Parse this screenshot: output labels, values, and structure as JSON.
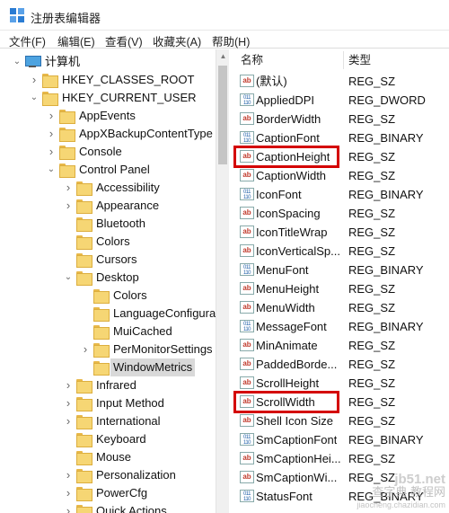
{
  "window": {
    "title": "注册表编辑器",
    "icon": "regedit-icon"
  },
  "menu": [
    "文件(F)",
    "编辑(E)",
    "查看(V)",
    "收藏夹(A)",
    "帮助(H)"
  ],
  "tree": [
    {
      "label": "计算机",
      "level": 0,
      "chevron": "expanded",
      "icon": "computer-icon"
    },
    {
      "label": "HKEY_CLASSES_ROOT",
      "level": 1,
      "chevron": "collapsed",
      "icon": "folder-icon"
    },
    {
      "label": "HKEY_CURRENT_USER",
      "level": 1,
      "chevron": "expanded",
      "icon": "folder-icon"
    },
    {
      "label": "AppEvents",
      "level": 2,
      "chevron": "collapsed",
      "icon": "folder-icon"
    },
    {
      "label": "AppXBackupContentType",
      "level": 2,
      "chevron": "collapsed",
      "icon": "folder-icon"
    },
    {
      "label": "Console",
      "level": 2,
      "chevron": "collapsed",
      "icon": "folder-icon"
    },
    {
      "label": "Control Panel",
      "level": 2,
      "chevron": "expanded",
      "icon": "folder-icon"
    },
    {
      "label": "Accessibility",
      "level": 3,
      "chevron": "collapsed",
      "icon": "folder-icon"
    },
    {
      "label": "Appearance",
      "level": 3,
      "chevron": "collapsed",
      "icon": "folder-icon"
    },
    {
      "label": "Bluetooth",
      "level": 3,
      "chevron": "none",
      "icon": "folder-icon"
    },
    {
      "label": "Colors",
      "level": 3,
      "chevron": "none",
      "icon": "folder-icon"
    },
    {
      "label": "Cursors",
      "level": 3,
      "chevron": "none",
      "icon": "folder-icon"
    },
    {
      "label": "Desktop",
      "level": 3,
      "chevron": "expanded",
      "icon": "folder-icon"
    },
    {
      "label": "Colors",
      "level": 4,
      "chevron": "none",
      "icon": "folder-icon"
    },
    {
      "label": "LanguageConfigura",
      "level": 4,
      "chevron": "none",
      "icon": "folder-icon"
    },
    {
      "label": "MuiCached",
      "level": 4,
      "chevron": "none",
      "icon": "folder-icon"
    },
    {
      "label": "PerMonitorSettings",
      "level": 4,
      "chevron": "collapsed",
      "icon": "folder-icon"
    },
    {
      "label": "WindowMetrics",
      "level": 4,
      "chevron": "none",
      "icon": "folder-icon",
      "selected": true
    },
    {
      "label": "Infrared",
      "level": 3,
      "chevron": "collapsed",
      "icon": "folder-icon"
    },
    {
      "label": "Input Method",
      "level": 3,
      "chevron": "collapsed",
      "icon": "folder-icon"
    },
    {
      "label": "International",
      "level": 3,
      "chevron": "collapsed",
      "icon": "folder-icon"
    },
    {
      "label": "Keyboard",
      "level": 3,
      "chevron": "none",
      "icon": "folder-icon"
    },
    {
      "label": "Mouse",
      "level": 3,
      "chevron": "none",
      "icon": "folder-icon"
    },
    {
      "label": "Personalization",
      "level": 3,
      "chevron": "collapsed",
      "icon": "folder-icon"
    },
    {
      "label": "PowerCfg",
      "level": 3,
      "chevron": "collapsed",
      "icon": "folder-icon"
    },
    {
      "label": "Quick Actions",
      "level": 3,
      "chevron": "collapsed",
      "icon": "folder-icon"
    }
  ],
  "list": {
    "columns": {
      "name": "名称",
      "type": "类型"
    },
    "rows": [
      {
        "name": "(默认)",
        "type": "REG_SZ",
        "icon": "string-value-icon"
      },
      {
        "name": "AppliedDPI",
        "type": "REG_DWORD",
        "icon": "binary-value-icon"
      },
      {
        "name": "BorderWidth",
        "type": "REG_SZ",
        "icon": "string-value-icon"
      },
      {
        "name": "CaptionFont",
        "type": "REG_BINARY",
        "icon": "binary-value-icon"
      },
      {
        "name": "CaptionHeight",
        "type": "REG_SZ",
        "icon": "string-value-icon",
        "highlighted": true
      },
      {
        "name": "CaptionWidth",
        "type": "REG_SZ",
        "icon": "string-value-icon"
      },
      {
        "name": "IconFont",
        "type": "REG_BINARY",
        "icon": "binary-value-icon"
      },
      {
        "name": "IconSpacing",
        "type": "REG_SZ",
        "icon": "string-value-icon"
      },
      {
        "name": "IconTitleWrap",
        "type": "REG_SZ",
        "icon": "string-value-icon"
      },
      {
        "name": "IconVerticalSp...",
        "type": "REG_SZ",
        "icon": "string-value-icon"
      },
      {
        "name": "MenuFont",
        "type": "REG_BINARY",
        "icon": "binary-value-icon"
      },
      {
        "name": "MenuHeight",
        "type": "REG_SZ",
        "icon": "string-value-icon"
      },
      {
        "name": "MenuWidth",
        "type": "REG_SZ",
        "icon": "string-value-icon"
      },
      {
        "name": "MessageFont",
        "type": "REG_BINARY",
        "icon": "binary-value-icon"
      },
      {
        "name": "MinAnimate",
        "type": "REG_SZ",
        "icon": "string-value-icon"
      },
      {
        "name": "PaddedBorde...",
        "type": "REG_SZ",
        "icon": "string-value-icon"
      },
      {
        "name": "ScrollHeight",
        "type": "REG_SZ",
        "icon": "string-value-icon"
      },
      {
        "name": "ScrollWidth",
        "type": "REG_SZ",
        "icon": "string-value-icon",
        "highlighted": true
      },
      {
        "name": "Shell Icon Size",
        "type": "REG_SZ",
        "icon": "string-value-icon"
      },
      {
        "name": "SmCaptionFont",
        "type": "REG_BINARY",
        "icon": "binary-value-icon"
      },
      {
        "name": "SmCaptionHei...",
        "type": "REG_SZ",
        "icon": "string-value-icon"
      },
      {
        "name": "SmCaptionWi...",
        "type": "REG_SZ",
        "icon": "string-value-icon"
      },
      {
        "name": "StatusFont",
        "type": "REG_BINARY",
        "icon": "binary-value-icon"
      }
    ]
  },
  "watermark": {
    "line1": "jb51.net",
    "line2": "查字典 教程网",
    "line3": "jiaocheng.chazidian.com"
  },
  "colors": {
    "highlight_box": "#d40000",
    "selection": "#d9d9d9",
    "folder": "#f6d674"
  }
}
